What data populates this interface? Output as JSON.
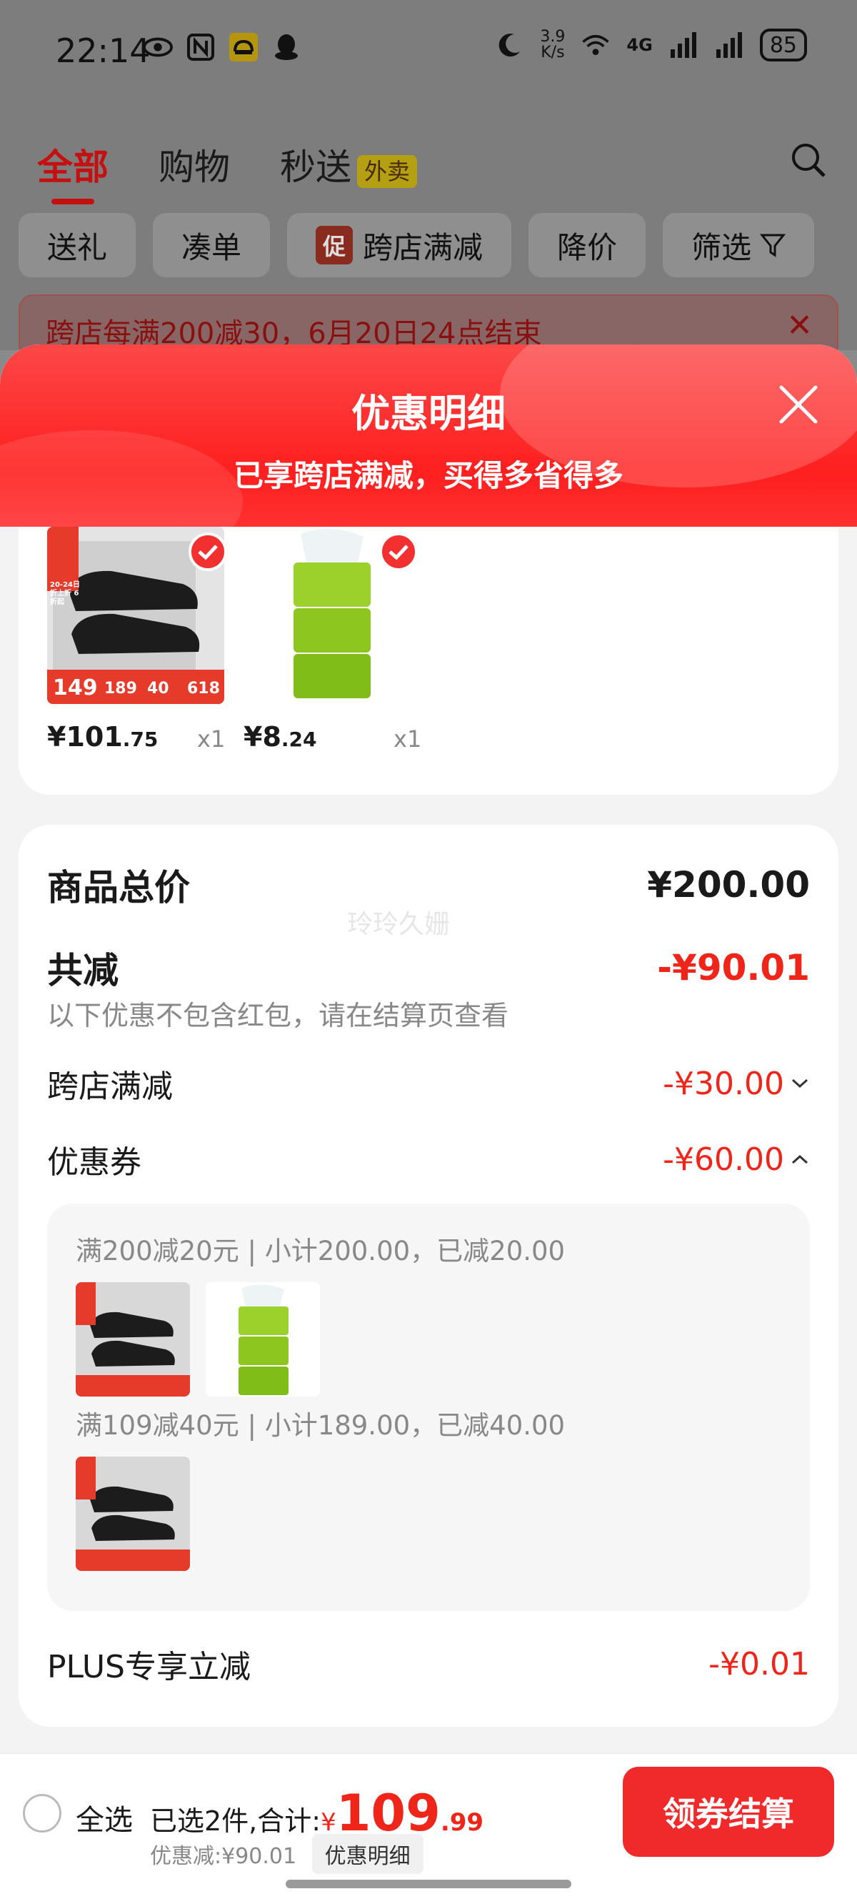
{
  "status_bar": {
    "time": "22:14",
    "net_speed_value": "3.9",
    "net_speed_unit": "K/s",
    "network": "4G",
    "battery": "85"
  },
  "background_page": {
    "tabs": [
      "全部",
      "购物",
      "秒送"
    ],
    "tab_badge": "外卖",
    "filters": [
      "送礼",
      "凑单",
      "跨店满减",
      "降价",
      "筛选"
    ],
    "filter_promo_tag": "促",
    "promo_strip": "跨店每满200减30，6月20日24点结束"
  },
  "sheet": {
    "title": "优惠明细",
    "subtitle": "已享跨店满减，买得多省得多",
    "products": [
      {
        "price_main": "¥101",
        "price_dec": ".75",
        "qty": "x1",
        "promo_tag": "20-24日",
        "promo_line": "折上折 6折起",
        "banner_price": "149",
        "banner_a": "189",
        "banner_b": "40",
        "banner_c": "618"
      },
      {
        "price_main": "¥8",
        "price_dec": ".24",
        "qty": "x1"
      }
    ]
  },
  "summary": {
    "total_label": "商品总价",
    "total_value": "¥200.00",
    "watermark": "玲玲久姗",
    "discount_label": "共减",
    "discount_value": "-¥90.01",
    "discount_note": "以下优惠不包含红包，请在结算页查看",
    "cross_store_label": "跨店满减",
    "cross_store_value": "-¥30.00",
    "coupon_label": "优惠券",
    "coupon_value": "-¥60.00",
    "coupon_lines": [
      "满200减20元 | 小计200.00，已减20.00",
      "满109减40元 | 小计189.00，已减40.00"
    ],
    "plus_label": "PLUS专享立减",
    "plus_value": "-¥0.01"
  },
  "bottom_bar": {
    "select_all": "全选",
    "selected_text": "已选2件,合计:",
    "currency": "¥",
    "total_int": "109",
    "total_dec": ".99",
    "saved_text": "优惠减:¥90.01",
    "detail_chip": "优惠明细",
    "checkout_label": "领券结算"
  },
  "colors": {
    "accent_red": "#f0251a",
    "header_red": "#ff2a2a"
  }
}
